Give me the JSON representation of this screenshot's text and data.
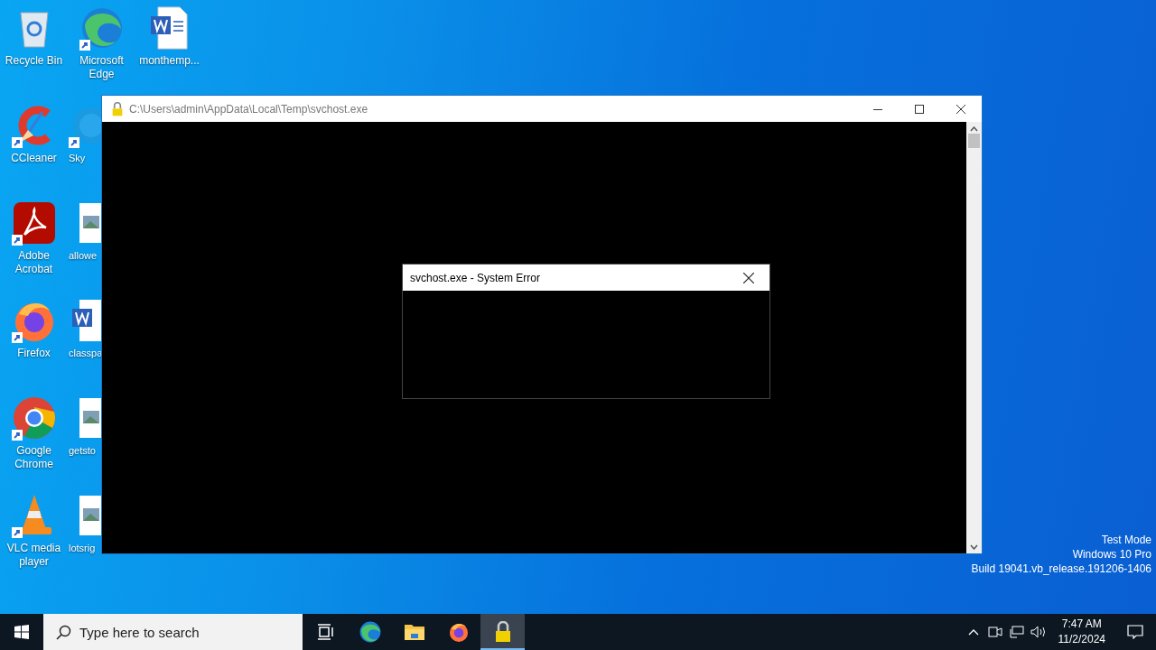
{
  "desktop_icons": [
    [
      {
        "label": "Recycle Bin",
        "shortcut": false,
        "covered": false
      },
      {
        "label": "CCleaner",
        "shortcut": true,
        "covered": false
      },
      {
        "label": "Adobe Acrobat",
        "shortcut": true,
        "covered": false
      },
      {
        "label": "Firefox",
        "shortcut": true,
        "covered": false
      },
      {
        "label": "Google Chrome",
        "shortcut": true,
        "covered": false
      },
      {
        "label": "VLC media player",
        "shortcut": true,
        "covered": false
      }
    ],
    [
      {
        "label": "Microsoft Edge",
        "shortcut": true,
        "covered": false
      },
      {
        "label": "Sky",
        "shortcut": true,
        "covered": true
      },
      {
        "label": "allowe",
        "shortcut": false,
        "covered": true
      },
      {
        "label": "classpa",
        "shortcut": false,
        "covered": true
      },
      {
        "label": "getsto",
        "shortcut": false,
        "covered": true
      },
      {
        "label": "lotsrig",
        "shortcut": false,
        "covered": true
      }
    ],
    [
      {
        "label": "monthemp...",
        "shortcut": false,
        "covered": false
      }
    ]
  ],
  "console_window": {
    "title": "C:\\Users\\admin\\AppData\\Local\\Temp\\svchost.exe"
  },
  "error_dialog": {
    "title": "svchost.exe - System Error"
  },
  "watermark_info": [
    "Test Mode",
    "Windows 10 Pro",
    "Build 19041.vb_release.191206-1406"
  ],
  "taskbar": {
    "search": {
      "placeholder": "Type here to search"
    },
    "apps": [
      {
        "kind": "taskview",
        "active": false
      },
      {
        "kind": "edge",
        "active": false
      },
      {
        "kind": "explorer",
        "active": false
      },
      {
        "kind": "firefox",
        "active": false
      },
      {
        "kind": "lock",
        "active": true
      }
    ],
    "clock": {
      "time": "7:47 AM",
      "date": "11/2/2024"
    }
  }
}
